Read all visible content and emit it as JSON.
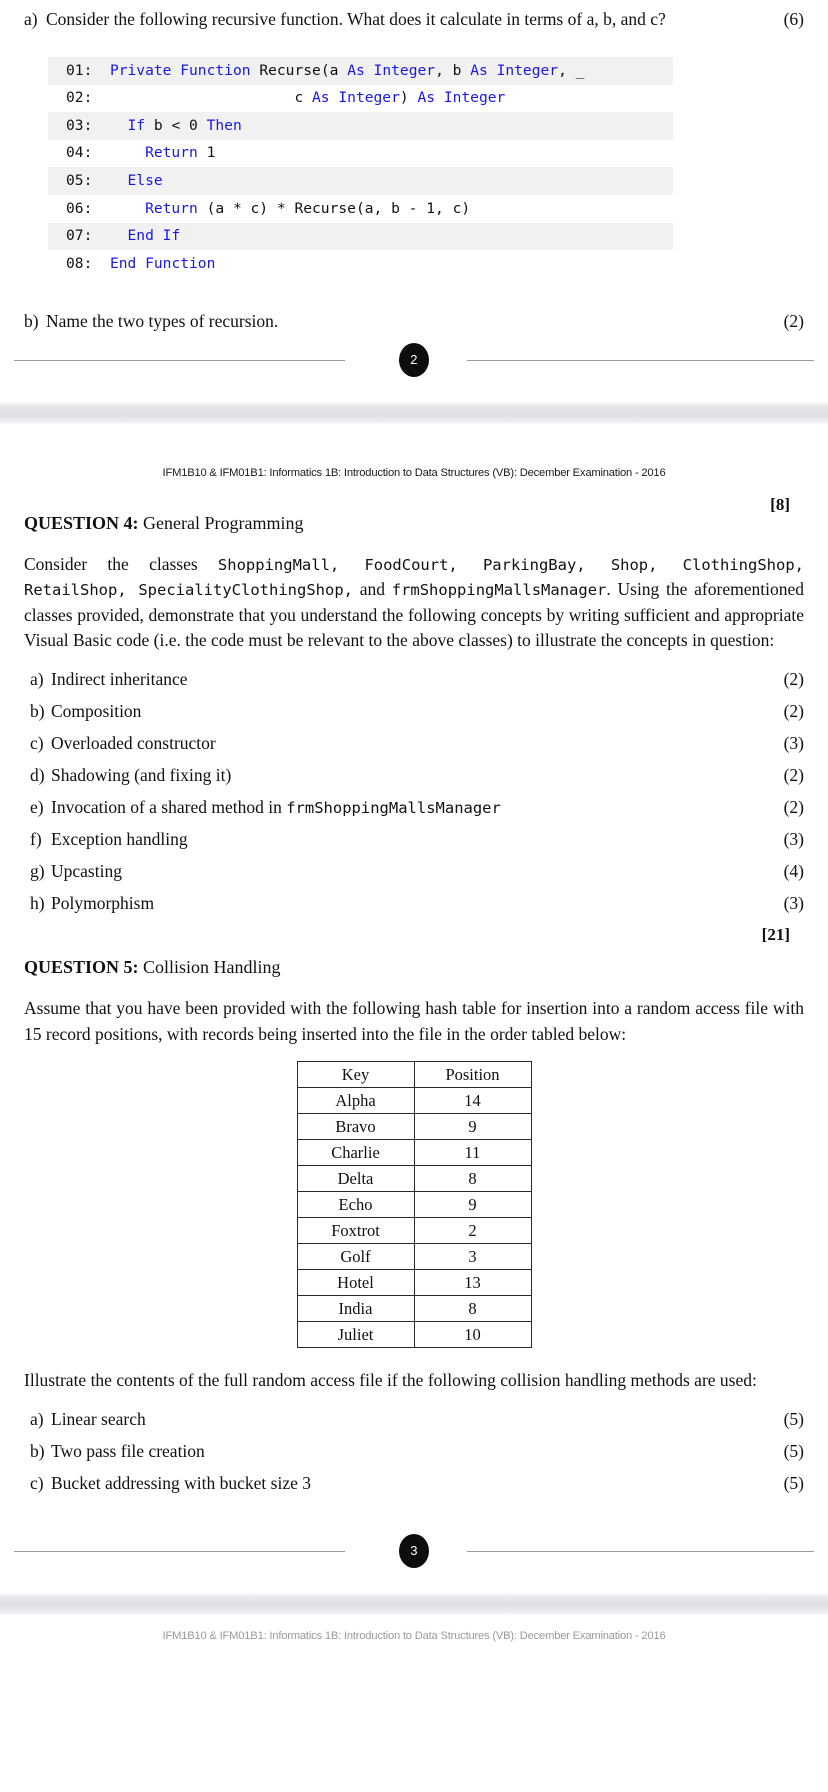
{
  "document": {
    "running_header": "IFM1B10 & IFM01B1: Informatics 1B: Introduction to Data Structures (VB): December Examination - 2016"
  },
  "page2": {
    "number": "2",
    "q3a": {
      "label": "a)",
      "text": "Consider the following recursive function. What does it calculate in terms of a, b, and c?",
      "marks": "(6)"
    },
    "code_listing": [
      {
        "num": "01:",
        "segments": [
          {
            "t": "  ",
            "k": false
          },
          {
            "t": "Private Function ",
            "k": true
          },
          {
            "t": "Recurse(a ",
            "k": false
          },
          {
            "t": "As Integer",
            "k": true
          },
          {
            "t": ", b ",
            "k": false
          },
          {
            "t": "As Integer",
            "k": true
          },
          {
            "t": ", _",
            "k": false
          }
        ]
      },
      {
        "num": "02:",
        "segments": [
          {
            "t": "                       c ",
            "k": false
          },
          {
            "t": "As Integer",
            "k": true
          },
          {
            "t": ") ",
            "k": false
          },
          {
            "t": "As Integer",
            "k": true
          }
        ]
      },
      {
        "num": "03:",
        "segments": [
          {
            "t": "    ",
            "k": false
          },
          {
            "t": "If",
            "k": true
          },
          {
            "t": " b < 0 ",
            "k": false
          },
          {
            "t": "Then",
            "k": true
          }
        ]
      },
      {
        "num": "04:",
        "segments": [
          {
            "t": "      ",
            "k": false
          },
          {
            "t": "Return",
            "k": true
          },
          {
            "t": " 1",
            "k": false
          }
        ]
      },
      {
        "num": "05:",
        "segments": [
          {
            "t": "    ",
            "k": false
          },
          {
            "t": "Else",
            "k": true
          }
        ]
      },
      {
        "num": "06:",
        "segments": [
          {
            "t": "      ",
            "k": false
          },
          {
            "t": "Return",
            "k": true
          },
          {
            "t": " (a * c) * Recurse(a, b - 1, c)",
            "k": false
          }
        ]
      },
      {
        "num": "07:",
        "segments": [
          {
            "t": "    ",
            "k": false
          },
          {
            "t": "End If",
            "k": true
          }
        ]
      },
      {
        "num": "08:",
        "segments": [
          {
            "t": "  ",
            "k": false
          },
          {
            "t": "End Function",
            "k": true
          }
        ]
      }
    ],
    "q3b": {
      "label": "b)",
      "text": "Name the two types of recursion.",
      "marks": "(2)"
    }
  },
  "page3": {
    "number": "3",
    "q3_total_marks": "[8]",
    "question4": {
      "number": "QUESTION 4:",
      "title": "General Programming",
      "intro_parts": [
        {
          "t": "Consider the classes ",
          "mono": false
        },
        {
          "t": "ShoppingMall, FoodCourt, ParkingBay, Shop, ClothingShop, RetailShop, SpecialityClothingShop,",
          "mono": true
        },
        {
          "t": " and ",
          "mono": false
        },
        {
          "t": "frmShoppingMallsManager",
          "mono": true
        },
        {
          "t": ". Using the aforementioned classes provided, demonstrate that you understand the following concepts by writing sufficient and appropriate Visual Basic code (i.e. the code must be relevant to the above classes) to illustrate the concepts in question:",
          "mono": false
        }
      ],
      "items": [
        {
          "label": "a)",
          "parts": [
            {
              "t": "Indirect inheritance",
              "mono": false
            }
          ],
          "marks": "(2)"
        },
        {
          "label": "b)",
          "parts": [
            {
              "t": "Composition",
              "mono": false
            }
          ],
          "marks": "(2)"
        },
        {
          "label": "c)",
          "parts": [
            {
              "t": "Overloaded constructor",
              "mono": false
            }
          ],
          "marks": "(3)"
        },
        {
          "label": "d)",
          "parts": [
            {
              "t": "Shadowing (and fixing it)",
              "mono": false
            }
          ],
          "marks": "(2)"
        },
        {
          "label": "e)",
          "parts": [
            {
              "t": "Invocation of a shared method in ",
              "mono": false
            },
            {
              "t": "frmShoppingMallsManager",
              "mono": true
            }
          ],
          "marks": "(2)"
        },
        {
          "label": "f)",
          "parts": [
            {
              "t": "Exception handling",
              "mono": false
            }
          ],
          "marks": "(3)"
        },
        {
          "label": "g)",
          "parts": [
            {
              "t": "Upcasting",
              "mono": false
            }
          ],
          "marks": "(4)"
        },
        {
          "label": "h)",
          "parts": [
            {
              "t": "Polymorphism",
              "mono": false
            }
          ],
          "marks": "(3)"
        }
      ],
      "total_marks": "[21]"
    },
    "question5": {
      "number": "QUESTION 5:",
      "title": "Collision Handling",
      "intro": "Assume that you have been provided with the following hash table for insertion into a random access file with 15 record positions, with records being inserted into the file in the order tabled below:",
      "hash_table": {
        "columns": [
          "Key",
          "Position"
        ],
        "rows": [
          [
            "Alpha",
            "14"
          ],
          [
            "Bravo",
            "9"
          ],
          [
            "Charlie",
            "11"
          ],
          [
            "Delta",
            "8"
          ],
          [
            "Echo",
            "9"
          ],
          [
            "Foxtrot",
            "2"
          ],
          [
            "Golf",
            "3"
          ],
          [
            "Hotel",
            "13"
          ],
          [
            "India",
            "8"
          ],
          [
            "Juliet",
            "10"
          ]
        ]
      },
      "outro": "Illustrate the contents of the full random access file if the following collision handling methods are used:",
      "items": [
        {
          "label": "a)",
          "text": "Linear search",
          "marks": "(5)"
        },
        {
          "label": "b)",
          "text": "Two pass file creation",
          "marks": "(5)"
        },
        {
          "label": "c)",
          "text": "Bucket addressing with bucket size 3",
          "marks": "(5)"
        }
      ]
    }
  }
}
